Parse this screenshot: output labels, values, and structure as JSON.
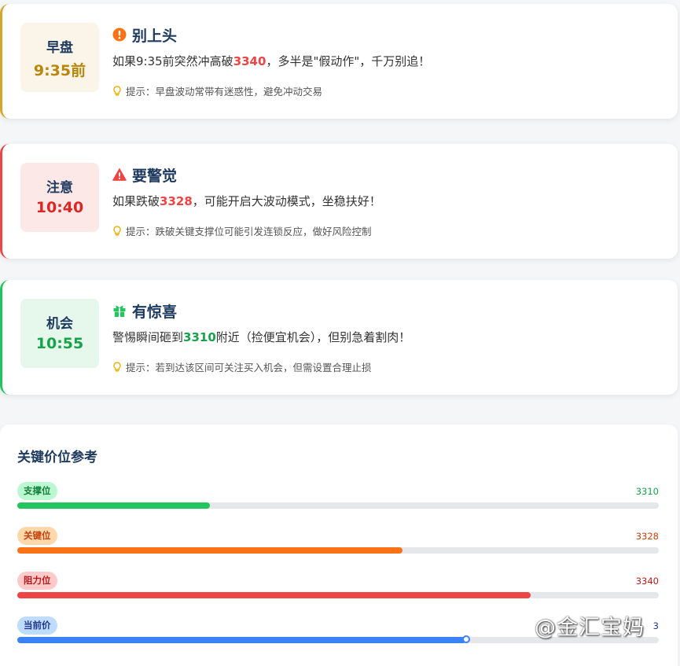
{
  "cards": [
    {
      "label": "早盘",
      "time": "9:35前",
      "title": "别上头",
      "icon": "exclamation-circle-icon",
      "msg_pre": "如果9:35前突然冲高破",
      "msg_hl": "3340",
      "msg_post": "，多半是\"假动作\"，千万别追！",
      "tip": "提示：早盘波动常带有迷惑性，避免冲动交易"
    },
    {
      "label": "注意",
      "time": "10:40",
      "title": "要警觉",
      "icon": "warning-triangle-icon",
      "msg_pre": "如果跌破",
      "msg_hl": "3328",
      "msg_post": "，可能开启大波动模式，坐稳扶好！",
      "tip": "提示：跌破关键支撑位可能引发连锁反应，做好风险控制"
    },
    {
      "label": "机会",
      "time": "10:55",
      "title": "有惊喜",
      "icon": "gift-icon",
      "msg_pre": "警惕瞬间砸到",
      "msg_hl": "3310",
      "msg_post": "附近（捡便宜机会），但别急着割肉！",
      "tip": "提示：若到达该区间可关注买入机会，但需设置合理止损"
    }
  ],
  "levels": {
    "title": "关键价位参考",
    "items": [
      {
        "label": "支撑位",
        "value": "3310",
        "fill_percent": 30,
        "color": "#22c55e",
        "badge_bg": "#bbf7d0",
        "badge_fg": "#15803d",
        "value_color": "#16a34a"
      },
      {
        "label": "关键位",
        "value": "3328",
        "fill_percent": 60,
        "color": "#f97316",
        "badge_bg": "#fed7aa",
        "badge_fg": "#c2410c",
        "value_color": "#c2410c"
      },
      {
        "label": "阻力位",
        "value": "3340",
        "fill_percent": 80,
        "color": "#ef4444",
        "badge_bg": "#fecaca",
        "badge_fg": "#b91c1c",
        "value_color": "#b91c1c"
      },
      {
        "label": "当前价",
        "value": "3",
        "fill_percent": 70,
        "color": "#3b82f6",
        "badge_bg": "#bfdbfe",
        "badge_fg": "#1e3a8a",
        "value_color": "#1e3a8a"
      }
    ]
  },
  "watermark": "@金汇宝妈"
}
